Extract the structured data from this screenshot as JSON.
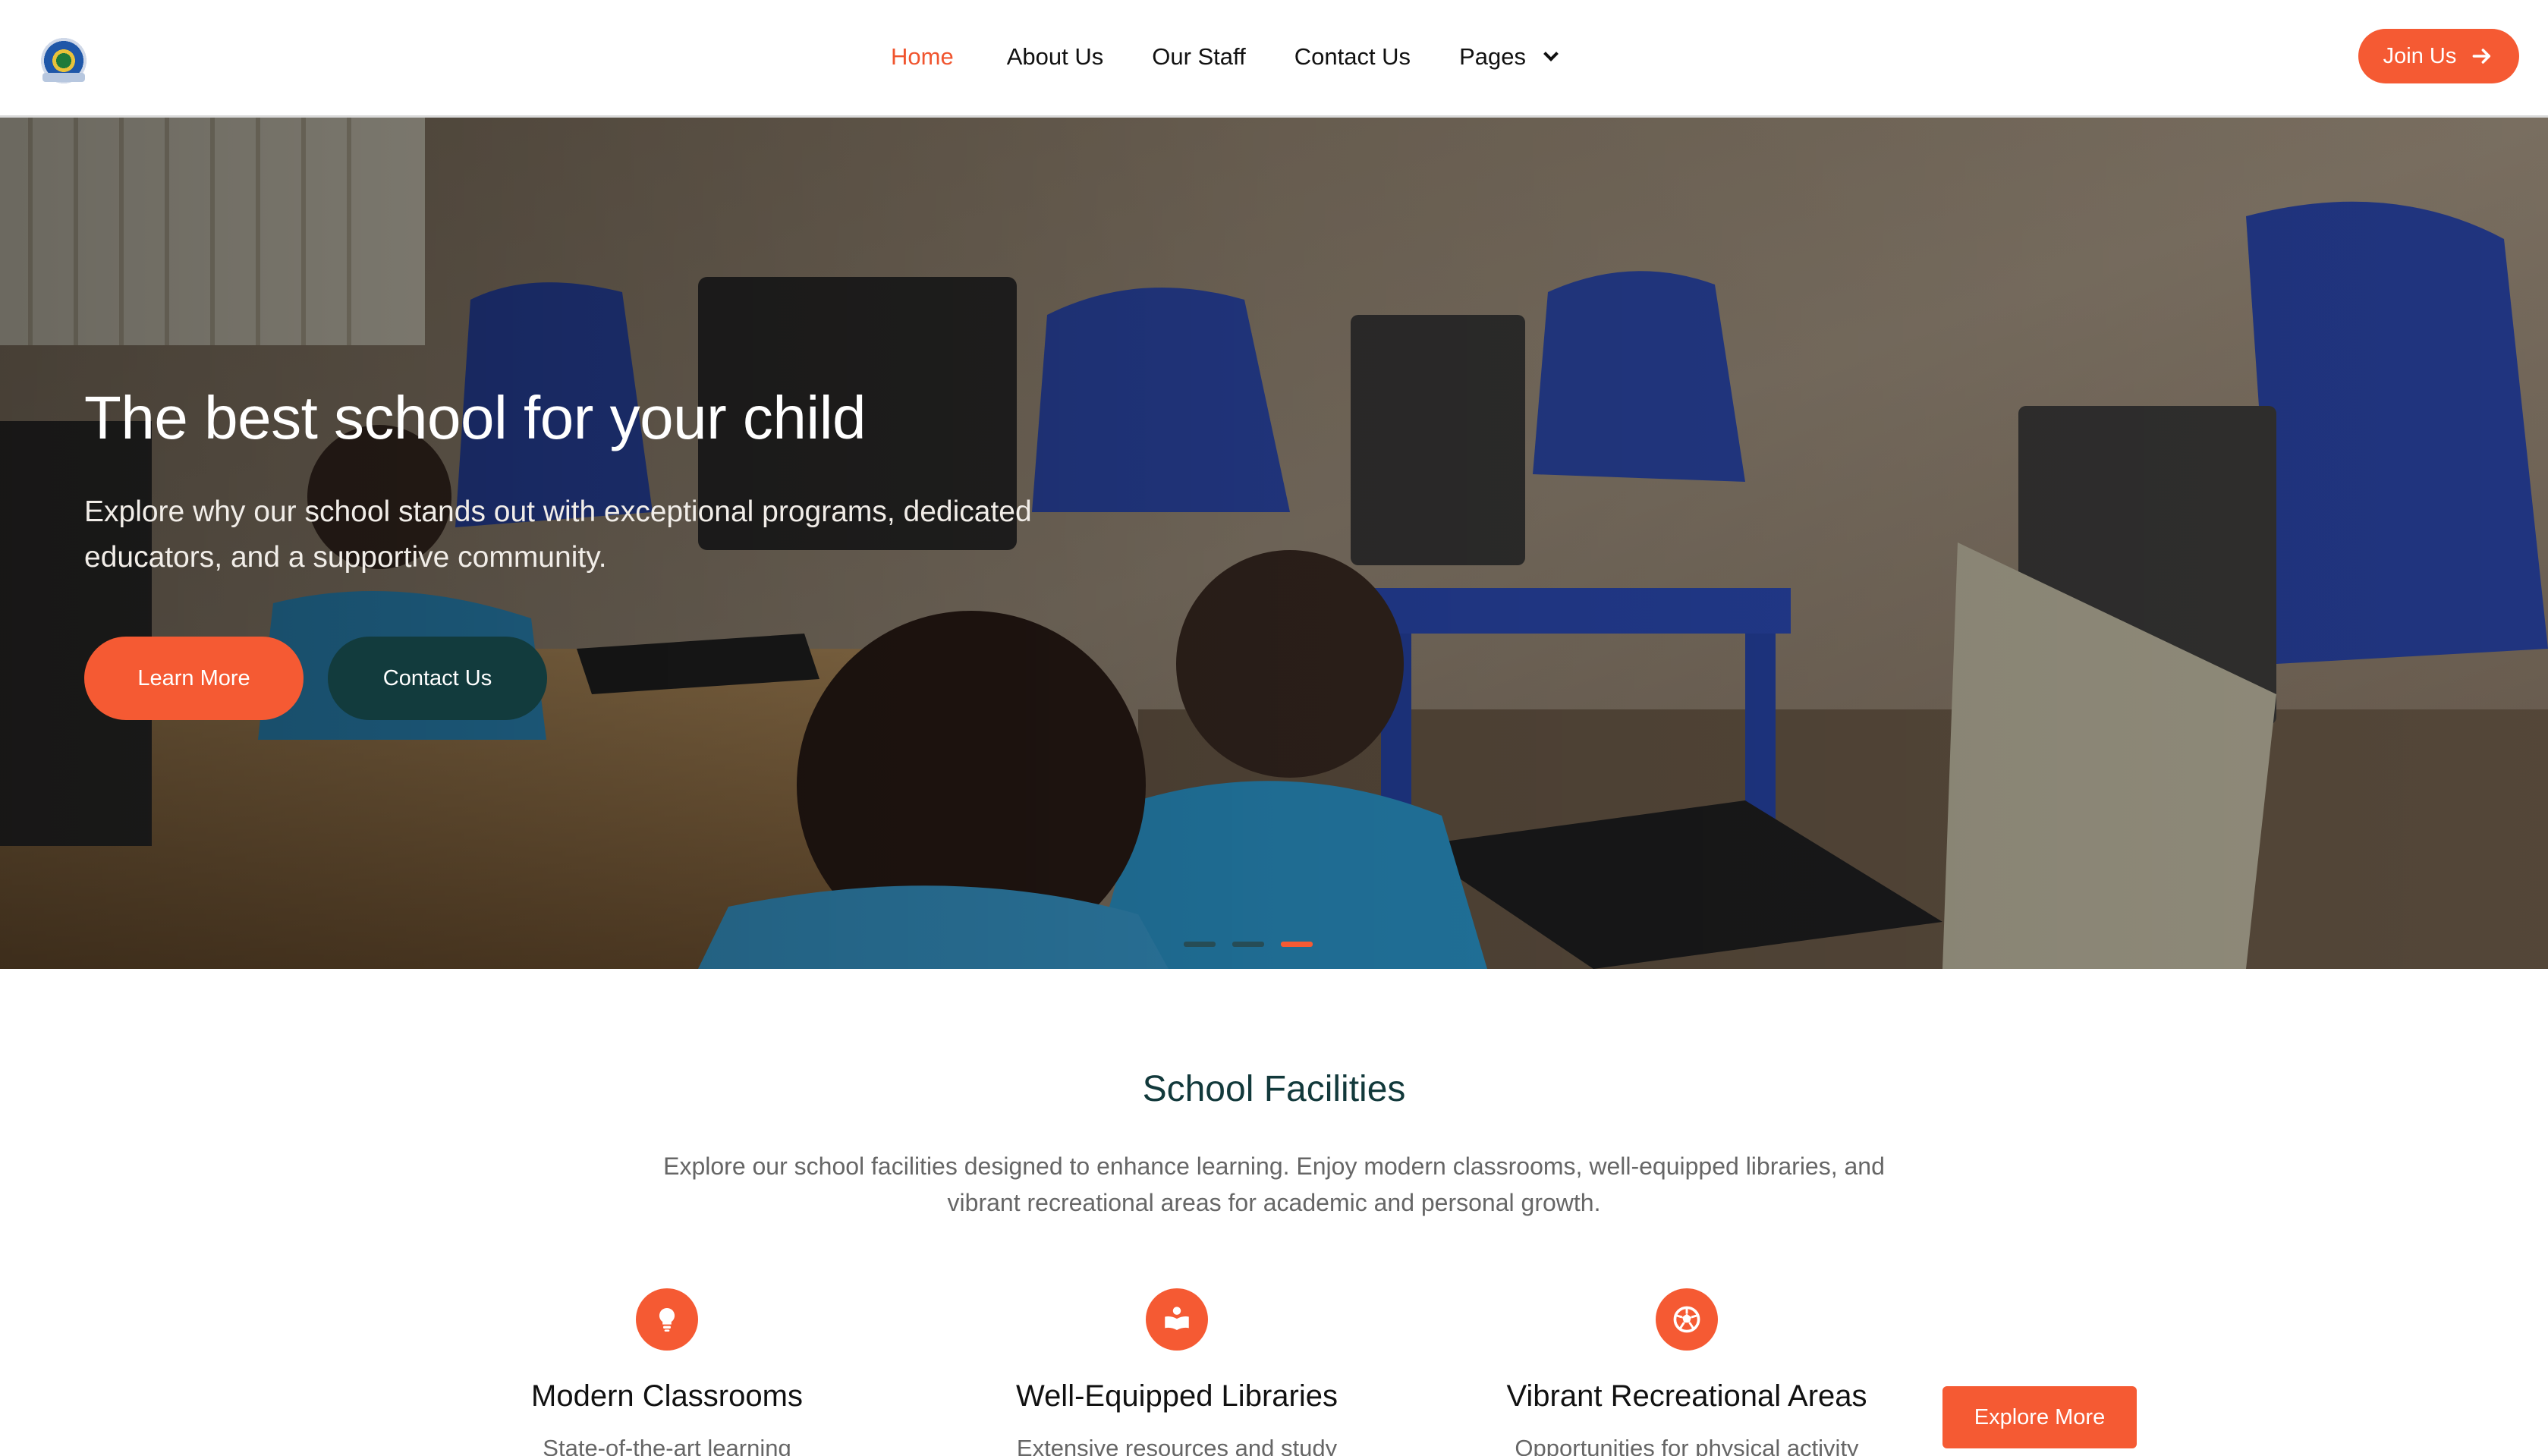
{
  "nav": {
    "links": [
      {
        "label": "Home"
      },
      {
        "label": "About Us"
      },
      {
        "label": "Our Staff"
      },
      {
        "label": "Contact Us"
      },
      {
        "label": "Pages"
      }
    ],
    "join_label": "Join Us"
  },
  "hero": {
    "title": "The best school for your child",
    "text": "Explore why our school stands out with exceptional programs, dedicated educators, and a supportive community.",
    "learn_label": "Learn More",
    "contact_label": "Contact Us",
    "slide_count": 3,
    "active_slide": 3
  },
  "facilities": {
    "title": "School Facilities",
    "text": "Explore our school facilities designed to enhance learning. Enjoy modern classrooms, well-equipped libraries, and vibrant recreational areas for academic and personal growth.",
    "items": [
      {
        "title": "Modern Classrooms",
        "desc": "State-of-the-art learning",
        "icon": "lightbulb-icon"
      },
      {
        "title": "Well-Equipped Libraries",
        "desc": "Extensive resources and study",
        "icon": "book-reader-icon"
      },
      {
        "title": "Vibrant Recreational Areas",
        "desc": "Opportunities for physical activity",
        "icon": "football-icon"
      }
    ],
    "explore_label": "Explore More"
  },
  "colors": {
    "accent": "#f55a33",
    "dark": "#123b3d",
    "active_nav": "#f0552f"
  }
}
